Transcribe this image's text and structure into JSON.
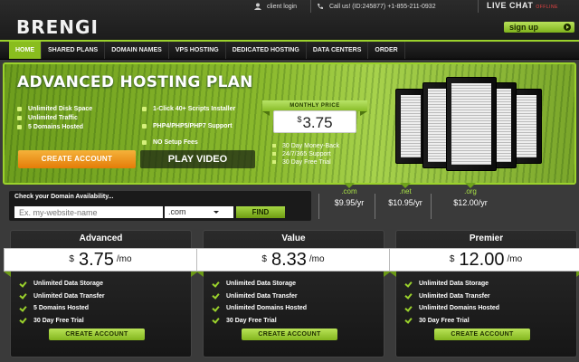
{
  "brand": {
    "logo": "BRENGI"
  },
  "utility": {
    "client_login": "client login",
    "call_us": "Call us! (ID:245877) +1-855-211-0932",
    "live_chat": "LIVE CHAT",
    "live_chat_status": "OFFLINE",
    "signup": "sign up"
  },
  "nav": {
    "items": [
      "HOME",
      "SHARED PLANS",
      "DOMAIN NAMES",
      "VPS HOSTING",
      "DEDICATED HOSTING",
      "DATA CENTERS",
      "ORDER"
    ],
    "active": "HOME"
  },
  "hero": {
    "title": "ADVANCED HOSTING PLAN",
    "features_left": [
      "Unlimited Disk Space",
      "Unlimited Traffic",
      "5 Domains Hosted"
    ],
    "features_right": [
      "1-Click 40+ Scripts Installer",
      "PHP4/PHP5/PHP7 Support",
      "NO Setup Fees"
    ],
    "create_account": "CREATE ACCOUNT",
    "play_video": "PLAY VIDEO",
    "monthly_label": "MONTHLY PRICE",
    "currency": "$",
    "price": "3.75",
    "perks": [
      "30 Day Money-Back",
      "24/7/365 Support",
      "30 Day Free Trial"
    ]
  },
  "domain": {
    "label": "Check your Domain Availability...",
    "placeholder": "Ex. my-website-name",
    "tld_selected": ".com",
    "find": "FIND",
    "tlds": [
      {
        "name": ".com",
        "price": "$9.95/yr"
      },
      {
        "name": ".net",
        "price": "$10.95/yr"
      },
      {
        "name": ".org",
        "price": "$12.00/yr"
      }
    ]
  },
  "plans": [
    {
      "name": "Advanced",
      "currency": "$",
      "price": "3.75",
      "per": "/mo",
      "features": [
        "Unlimited Data Storage",
        "Unlimited Data Transfer",
        "5 Domains Hosted",
        "30 Day Free Trial"
      ],
      "button": "CREATE ACCOUNT"
    },
    {
      "name": "Value",
      "currency": "$",
      "price": "8.33",
      "per": "/mo",
      "features": [
        "Unlimited Data Storage",
        "Unlimited Data Transfer",
        "Unlimited Domains Hosted",
        "30 Day Free Trial"
      ],
      "button": "CREATE ACCOUNT"
    },
    {
      "name": "Premier",
      "currency": "$",
      "price": "12.00",
      "per": "/mo",
      "features": [
        "Unlimited Data Storage",
        "Unlimited Data Transfer",
        "Unlimited Domains Hosted",
        "30 Day Free Trial"
      ],
      "button": "CREATE ACCOUNT"
    }
  ],
  "colors": {
    "accent": "#9bd22c",
    "cta_orange": "#e47c08",
    "background": "#3a3a3a"
  }
}
